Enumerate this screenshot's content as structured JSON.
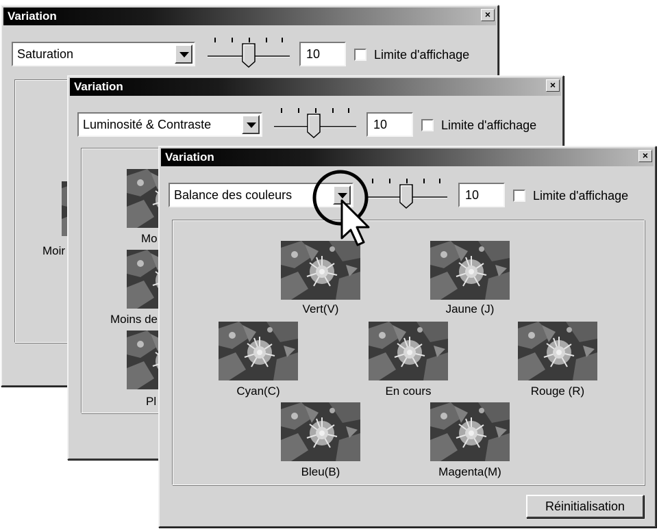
{
  "windows": [
    {
      "title": "Variation",
      "close_label": "×",
      "mode_select": "Saturation",
      "value": "10",
      "checkbox_label": "Limite d'affichage",
      "partial_labels": [
        "Moir"
      ]
    },
    {
      "title": "Variation",
      "close_label": "×",
      "mode_select": "Luminosité & Contraste",
      "value": "10",
      "checkbox_label": "Limite d'affichage",
      "partial_labels": [
        "Mo",
        "Moins de",
        "Pl"
      ]
    },
    {
      "title": "Variation",
      "close_label": "×",
      "mode_select": "Balance des couleurs",
      "value": "10",
      "checkbox_label": "Limite d'affichage",
      "variations": [
        {
          "label": "Vert(V)"
        },
        {
          "label": "Jaune (J)"
        },
        {
          "label": "Cyan(C)"
        },
        {
          "label": "En cours"
        },
        {
          "label": "Rouge (R)"
        },
        {
          "label": "Bleu(B)"
        },
        {
          "label": "Magenta(M)"
        }
      ],
      "reset_button": "Réinitialisation"
    }
  ],
  "icons": {
    "slider_thumb": "slider-thumb-icon",
    "dropdown": "chevron-down-icon",
    "cursor": "mouse-pointer-icon",
    "highlight": "highlight-circle-icon"
  }
}
